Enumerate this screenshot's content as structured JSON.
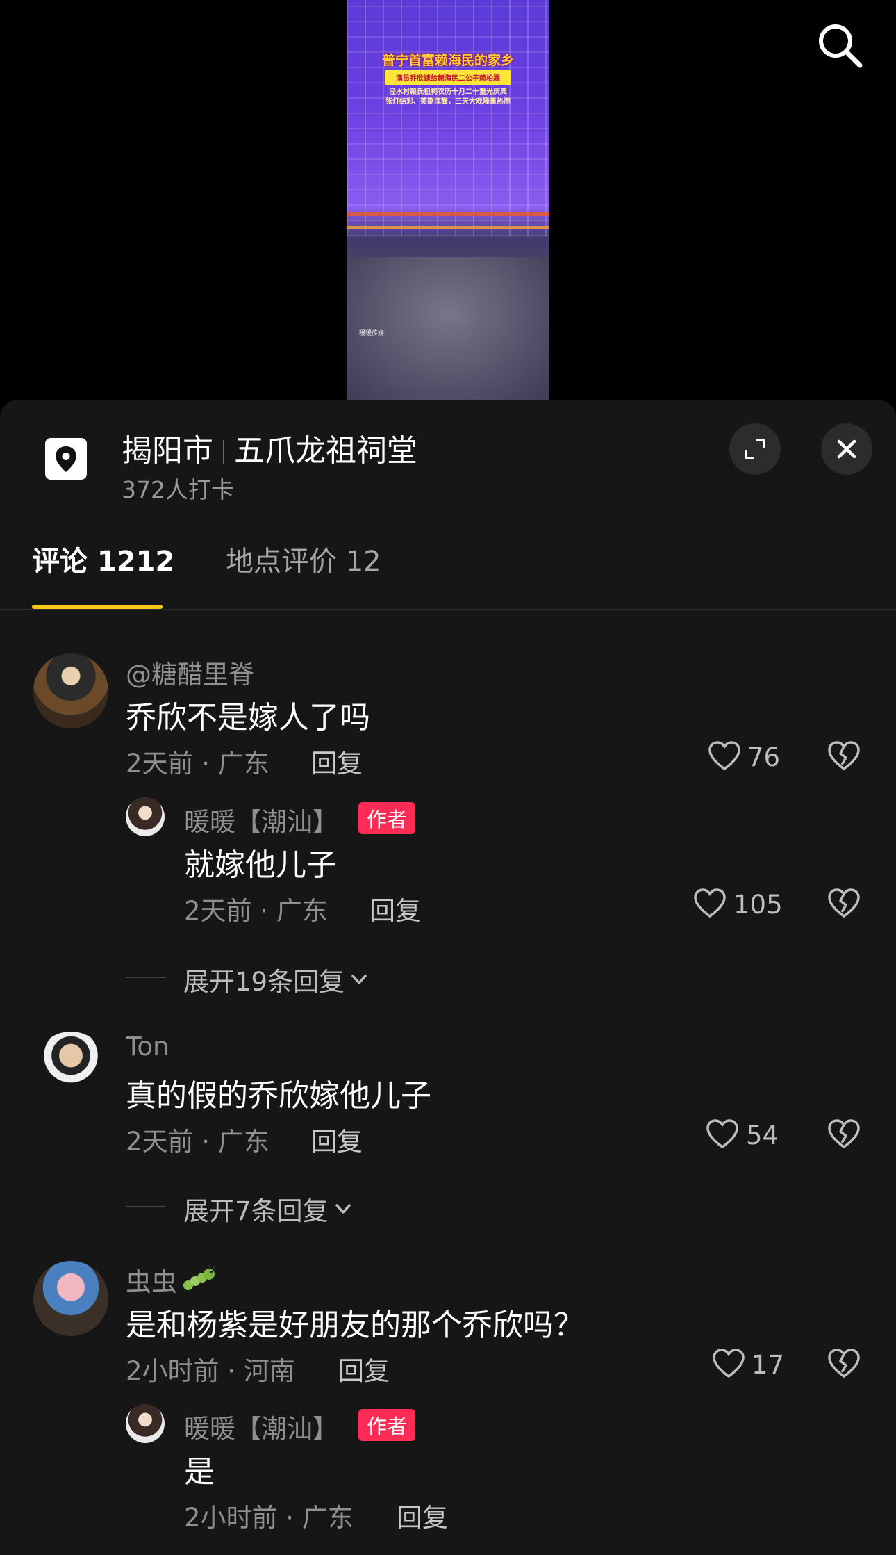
{
  "video": {
    "title": "普宁首富赖海民的家乡",
    "subtitle": "演员乔欣嫁给赖海民二公子赖柏霖",
    "caption_lines": [
      "泾水村赖氏祖祠农历十月二十重光庆典",
      "张灯结彩、英歌挥鼓，三天大戏隆重热闹"
    ],
    "watermark": "暖暖传媒"
  },
  "location": {
    "city": "揭阳市",
    "place": "五爪龙祖祠堂",
    "checkins": "372人打卡"
  },
  "tabs": [
    {
      "label": "评论 1212"
    },
    {
      "label": "地点评价 12"
    }
  ],
  "comments": [
    {
      "user": "@糖醋里脊",
      "text": "乔欣不是嫁人了吗",
      "meta": "2天前 · 广东",
      "reply_label": "回复",
      "likes": "76",
      "replies": [
        {
          "user": "暖暖【潮汕】",
          "badge": "作者",
          "text": "就嫁他儿子",
          "meta": "2天前 · 广东",
          "reply_label": "回复",
          "likes": "105"
        }
      ],
      "expand_label": "展开19条回复"
    },
    {
      "user": "Ton",
      "text": "真的假的乔欣嫁他儿子",
      "meta": "2天前 · 广东",
      "reply_label": "回复",
      "likes": "54",
      "expand_label": "展开7条回复"
    },
    {
      "user": "虫虫",
      "text": "是和杨紫是好朋友的那个乔欣吗？",
      "meta": "2小时前 · 河南",
      "reply_label": "回复",
      "likes": "17",
      "replies": [
        {
          "user": "暖暖【潮汕】",
          "badge": "作者",
          "text": "是",
          "meta": "2小时前 · 广东",
          "reply_label": "回复"
        }
      ]
    }
  ],
  "colors": {
    "background": "#000000",
    "sheet": "#161616",
    "tab_underline": "#f5c518",
    "author_badge": "#fe2c55",
    "secondary_text": "#8f8f8f"
  }
}
